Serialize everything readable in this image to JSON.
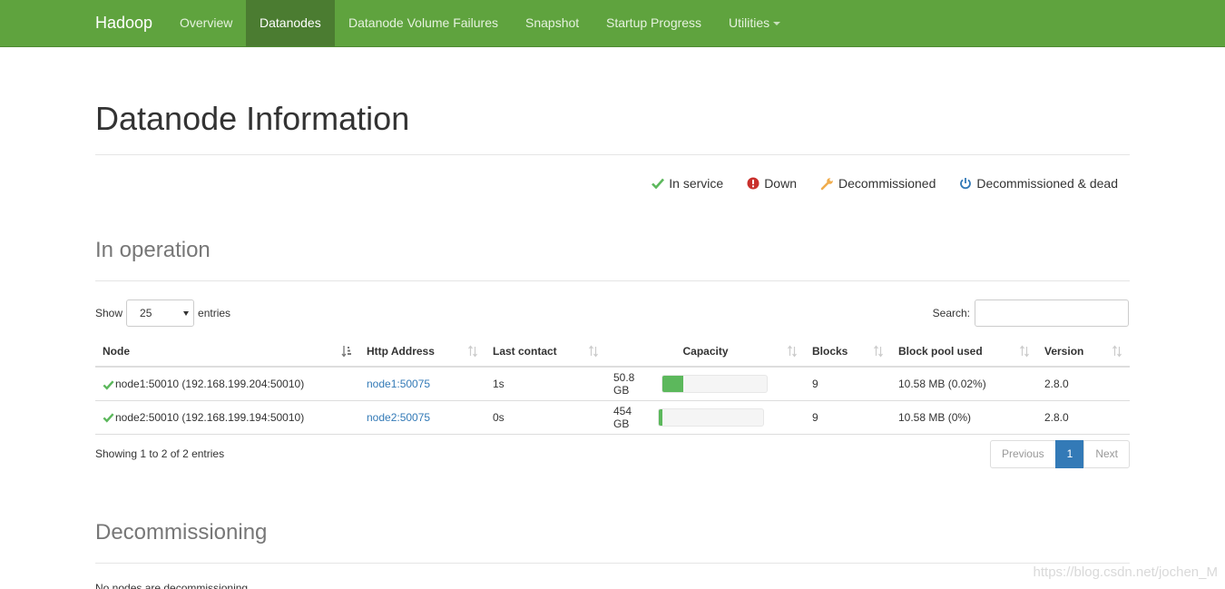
{
  "navbar": {
    "brand": "Hadoop",
    "items": [
      {
        "label": "Overview"
      },
      {
        "label": "Datanodes"
      },
      {
        "label": "Datanode Volume Failures"
      },
      {
        "label": "Snapshot"
      },
      {
        "label": "Startup Progress"
      },
      {
        "label": "Utilities"
      }
    ],
    "active": "Datanodes",
    "color": "#5fa33e"
  },
  "page_title": "Datanode Information",
  "legend": [
    {
      "label": "In service",
      "icon": "check-icon",
      "color": "#5cb85c"
    },
    {
      "label": "Down",
      "icon": "exclamation-circle-icon",
      "color": "#c9302c"
    },
    {
      "label": "Decommissioned",
      "icon": "wrench-icon",
      "color": "#f0ad4e"
    },
    {
      "label": "Decommissioned & dead",
      "icon": "power-icon",
      "color": "#337ab7"
    }
  ],
  "in_operation": {
    "title": "In operation",
    "show_label": "Show",
    "entries_label": "entries",
    "page_size": "25",
    "search_label": "Search:",
    "search_value": "",
    "columns": [
      "Node",
      "Http Address",
      "Last contact",
      "Capacity",
      "Blocks",
      "Block pool used",
      "Version"
    ],
    "rows": [
      {
        "node": "node1:50010 (192.168.199.204:50010)",
        "http": "node1:50075",
        "last_contact": "1s",
        "capacity": "50.8 GB",
        "used_fraction": 0.2,
        "blocks": "9",
        "block_pool_used": "10.58 MB (0.02%)",
        "version": "2.8.0"
      },
      {
        "node": "node2:50010 (192.168.199.194:50010)",
        "http": "node2:50075",
        "last_contact": "0s",
        "capacity": "454 GB",
        "used_fraction": 0.03,
        "blocks": "9",
        "block_pool_used": "10.58 MB (0%)",
        "version": "2.8.0"
      }
    ],
    "info": "Showing 1 to 2 of 2 entries",
    "pagination": {
      "previous": "Previous",
      "current": "1",
      "next": "Next"
    }
  },
  "decommissioning": {
    "title": "Decommissioning",
    "partial_text": "No nodes are decommissioning"
  },
  "watermark": "https://blog.csdn.net/jochen_M"
}
